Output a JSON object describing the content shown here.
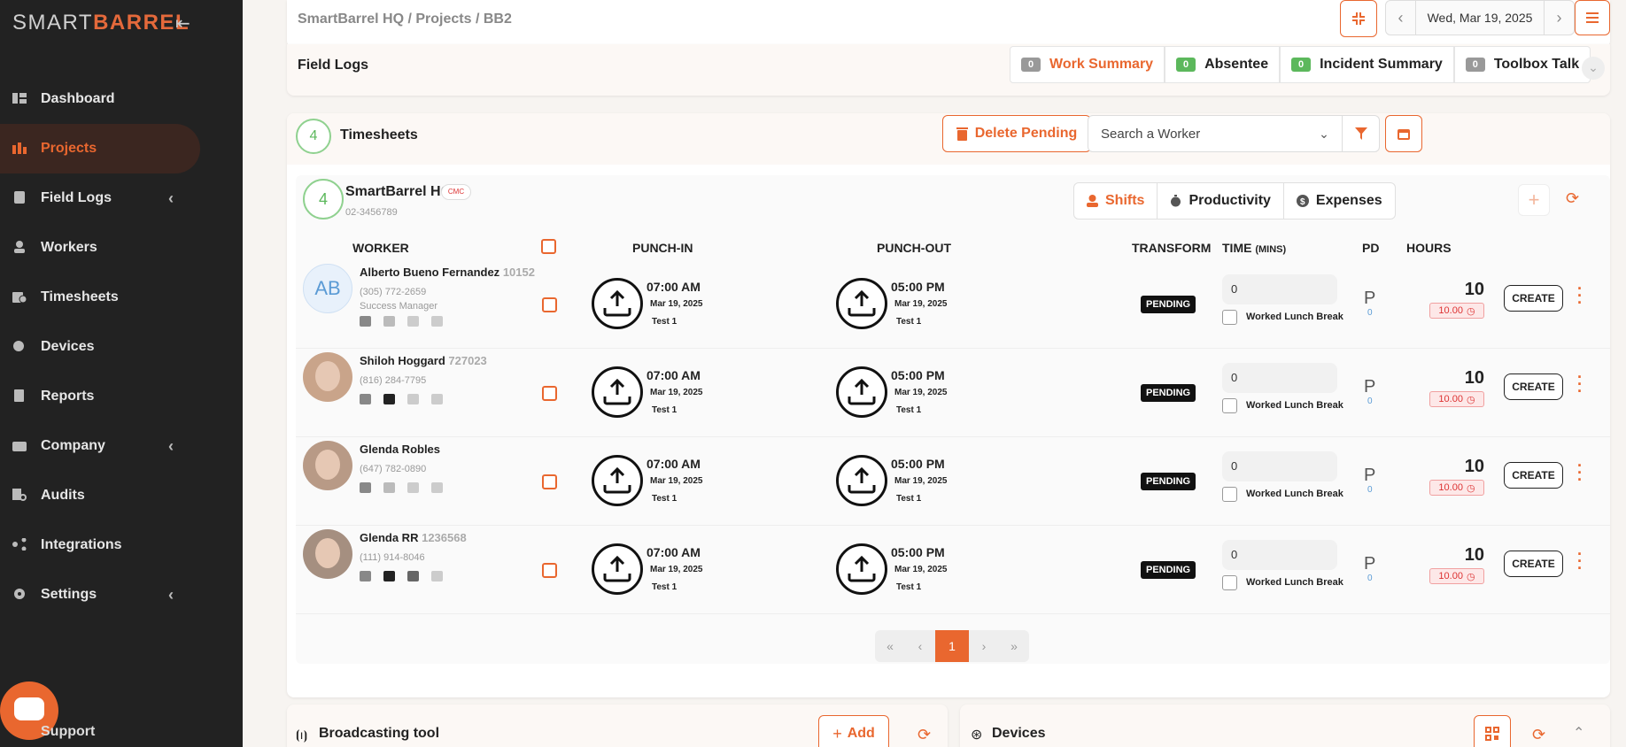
{
  "sidebar": {
    "logo_pre": "SMART",
    "logo_b": "B",
    "logo_a": "A",
    "logo_post": "RREL",
    "items": [
      {
        "label": "Dashboard"
      },
      {
        "label": "Projects"
      },
      {
        "label": "Field Logs"
      },
      {
        "label": "Workers"
      },
      {
        "label": "Timesheets"
      },
      {
        "label": "Devices"
      },
      {
        "label": "Reports"
      },
      {
        "label": "Company"
      },
      {
        "label": "Audits"
      },
      {
        "label": "Integrations"
      },
      {
        "label": "Settings"
      }
    ],
    "support": "Support"
  },
  "header": {
    "breadcrumb": "SmartBarrel HQ  /  Projects  /  BB2",
    "date": "Wed, Mar 19, 2025"
  },
  "fieldlogs": {
    "title": "Field Logs",
    "chips": [
      {
        "count": "0",
        "label": "Work Summary"
      },
      {
        "count": "0",
        "label": "Absentee"
      },
      {
        "count": "0",
        "label": "Incident Summary"
      },
      {
        "count": "0",
        "label": "Toolbox Talk"
      }
    ]
  },
  "timesheets": {
    "count": "4",
    "title": "Timesheets",
    "delete_label": "Delete Pending",
    "search_placeholder": "Search a Worker"
  },
  "company": {
    "count": "4",
    "name": "SmartBarrel HQ",
    "phone": "02-3456789",
    "tag": "CMC",
    "tabs": {
      "shifts": "Shifts",
      "productivity": "Productivity",
      "expenses": "Expenses"
    }
  },
  "columns": {
    "worker": "WORKER",
    "punch_in": "PUNCH-IN",
    "punch_out": "PUNCH-OUT",
    "transform": "TRANSFORM",
    "time": "TIME",
    "time_unit": "(MINS)",
    "pd": "PD",
    "hours": "HOURS"
  },
  "rows": [
    {
      "initials": "AB",
      "name": "Alberto Bueno Fernandez",
      "id": "10152",
      "phone": "(305) 772-2659",
      "role": "Success Manager",
      "in_time": "07:00 AM",
      "in_date": "Mar 19, 2025",
      "in_note": "Test 1",
      "out_time": "05:00 PM",
      "out_date": "Mar 19, 2025",
      "out_note": "Test 1",
      "status": "PENDING",
      "time_val": "0",
      "lunch": "Worked Lunch Break",
      "pd": "P",
      "pd_sub": "0",
      "hours": "10",
      "hours_tag": "10.00",
      "create": "CREATE"
    },
    {
      "initials": "",
      "name": "Shiloh Hoggard",
      "id": "727023",
      "phone": "(816) 284-7795",
      "role": "",
      "in_time": "07:00 AM",
      "in_date": "Mar 19, 2025",
      "in_note": "Test 1",
      "out_time": "05:00 PM",
      "out_date": "Mar 19, 2025",
      "out_note": "Test 1",
      "status": "PENDING",
      "time_val": "0",
      "lunch": "Worked Lunch Break",
      "pd": "P",
      "pd_sub": "0",
      "hours": "10",
      "hours_tag": "10.00",
      "create": "CREATE"
    },
    {
      "initials": "",
      "name": "Glenda Robles",
      "id": "",
      "phone": "(647) 782-0890",
      "role": "",
      "in_time": "07:00 AM",
      "in_date": "Mar 19, 2025",
      "in_note": "Test 1",
      "out_time": "05:00 PM",
      "out_date": "Mar 19, 2025",
      "out_note": "Test 1",
      "status": "PENDING",
      "time_val": "0",
      "lunch": "Worked Lunch Break",
      "pd": "P",
      "pd_sub": "0",
      "hours": "10",
      "hours_tag": "10.00",
      "create": "CREATE"
    },
    {
      "initials": "",
      "name": "Glenda RR",
      "id": "1236568",
      "phone": "(111) 914-8046",
      "role": "",
      "in_time": "07:00 AM",
      "in_date": "Mar 19, 2025",
      "in_note": "Test 1",
      "out_time": "05:00 PM",
      "out_date": "Mar 19, 2025",
      "out_note": "Test 1",
      "status": "PENDING",
      "time_val": "0",
      "lunch": "Worked Lunch Break",
      "pd": "P",
      "pd_sub": "0",
      "hours": "10",
      "hours_tag": "10.00",
      "create": "CREATE"
    }
  ],
  "pagination": {
    "first": "«",
    "prev": "‹",
    "current": "1",
    "next": "›",
    "last": "»"
  },
  "broadcast": {
    "title": "Broadcasting tool",
    "add": "Add"
  },
  "devices": {
    "title": "Devices"
  },
  "colors": {
    "accent": "#e9672f",
    "sidebar": "#222222",
    "green": "#5cb85c"
  }
}
